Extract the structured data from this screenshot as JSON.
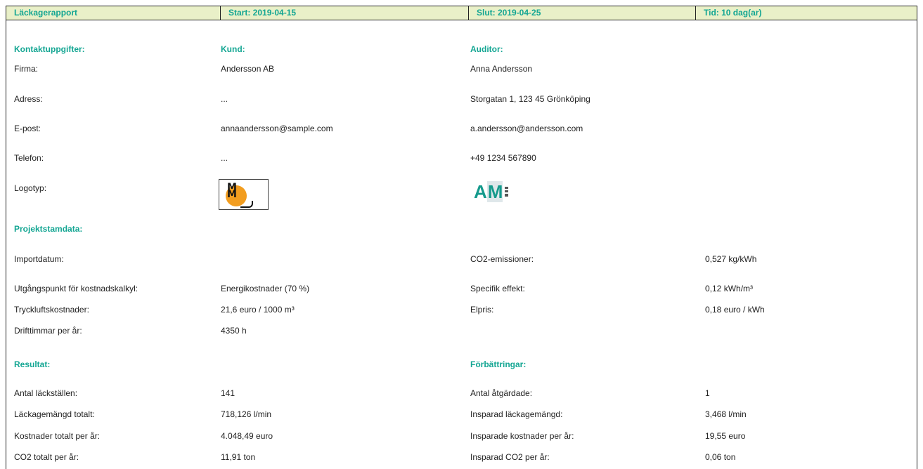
{
  "header": {
    "title": "Läckagerapport",
    "start": "Start: 2019-04-15",
    "end": "Slut: 2019-04-25",
    "duration": "Tid: 10 dag(ar)"
  },
  "contact": {
    "heading": "Kontaktuppgifter:",
    "customer_heading": "Kund:",
    "auditor_heading": "Auditor:",
    "rows": [
      {
        "label": "Firma:",
        "customer": "Andersson AB",
        "auditor": "Anna Andersson"
      },
      {
        "label": "Adress:",
        "customer": "...",
        "auditor": "Storgatan 1, 123 45 Grönköping"
      },
      {
        "label": "E-post:",
        "customer": "annaandersson@sample.com",
        "auditor": "a.andersson@andersson.com"
      },
      {
        "label": "Telefon:",
        "customer": "...",
        "auditor": "+49 1234 567890"
      },
      {
        "label": "Logotyp:"
      }
    ],
    "customer_logo": {
      "icon": "mm-logo",
      "text": "MM"
    },
    "auditor_logo": {
      "icon": "am-logo",
      "text_a": "A",
      "text_m": "M"
    }
  },
  "project": {
    "heading": "Projektstamdata:",
    "left": [
      {
        "label": "Importdatum:",
        "value": ""
      },
      {
        "label": "Utgångspunkt för kostnadskalkyl:",
        "value": "Energikostnader (70 %)"
      },
      {
        "label": "Tryckluftskostnader:",
        "value": "21,6 euro / 1000 m³"
      },
      {
        "label": "Drifttimmar per år:",
        "value": "4350 h"
      }
    ],
    "right": [
      {
        "label": "CO2-emissioner:",
        "value": "0,527 kg/kWh"
      },
      {
        "label": "Specifik effekt:",
        "value": "0,12 kWh/m³"
      },
      {
        "label": "Elpris:",
        "value": "0,18 euro / kWh"
      }
    ]
  },
  "results": {
    "heading": "Resultat:",
    "rows": [
      {
        "label": "Antal läckställen:",
        "value": "141"
      },
      {
        "label": "Läckagemängd totalt:",
        "value": "718,126 l/min"
      },
      {
        "label": "Kostnader totalt per år:",
        "value": "4.048,49 euro"
      },
      {
        "label": "CO2 totalt per år:",
        "value": "11,91 ton"
      }
    ]
  },
  "improvements": {
    "heading": "Förbättringar:",
    "rows": [
      {
        "label": "Antal åtgärdade:",
        "value": "1"
      },
      {
        "label": "Insparad läckagemängd:",
        "value": "3,468 l/min"
      },
      {
        "label": "Insparade kostnader per år:",
        "value": "19,55 euro"
      },
      {
        "label": "Insparad CO2 per år:",
        "value": "0,06 ton"
      }
    ]
  },
  "colors": {
    "accent": "#14a693",
    "header_bg": "#e9f0c8",
    "logo_orange": "#f29d1f"
  }
}
